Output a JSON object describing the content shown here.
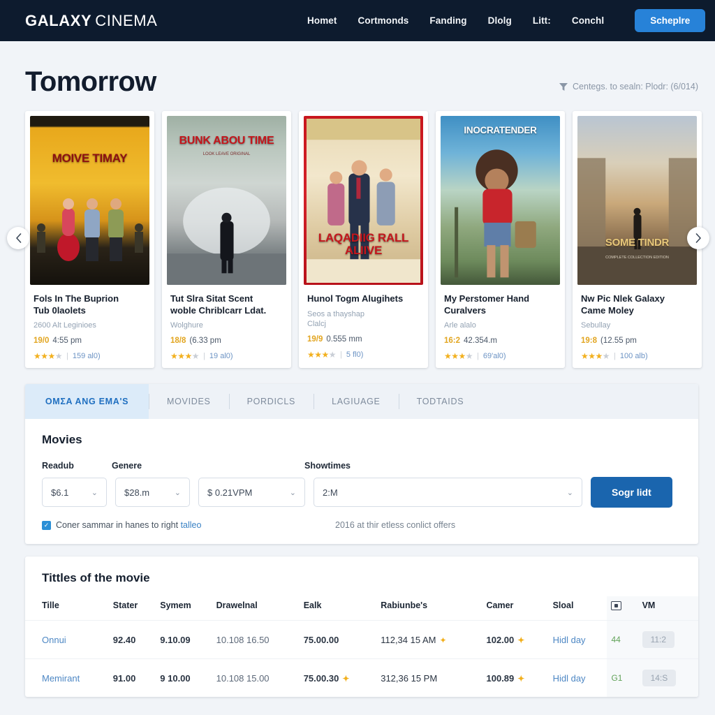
{
  "header": {
    "brand_bold": "GALAXY",
    "brand_light": "CINEMA",
    "nav": [
      {
        "label": "Homet"
      },
      {
        "label": "Cortmonds"
      },
      {
        "label": "Fanding"
      },
      {
        "label": "Dlolg"
      },
      {
        "label": "Litt:"
      },
      {
        "label": "Conchl"
      }
    ],
    "cta_label": "Scheplre"
  },
  "page": {
    "title": "Tomorrow",
    "meta": "Centegs. to sealn: Plodr: (6/014)",
    "filter_icon": "funnel-icon"
  },
  "carousel": {
    "prev_icon": "chevron-left-icon",
    "next_icon": "chevron-right-icon",
    "cards": [
      {
        "poster_text": "MOIVE TIMAY",
        "poster_sub": "",
        "title_l1": "Fols In The Buprion",
        "title_l2": "Tub 0laolets",
        "sub_l1": "2600 Alt Leginioes",
        "sub_l2": "",
        "badge": "19/0",
        "time": "4:55 pm",
        "stars_on": 3,
        "stars_off": 1,
        "count": "159 al0)"
      },
      {
        "poster_text": "BUNK ABOU TIME",
        "poster_sub": "LOOK LEAVE ORIGINAL",
        "title_l1": "Tut Slra Sitat Scent",
        "title_l2": "woble Chriblcarr Ldat.",
        "sub_l1": "Wolghure",
        "sub_l2": "",
        "badge": "18/8",
        "time": "(6.33 pm",
        "stars_on": 3,
        "stars_off": 1,
        "count": "19 al0)"
      },
      {
        "poster_text": "LAQADIIG RALL ALIIVE",
        "poster_sub": "",
        "title_l1": "Hunol Togm Alugihets",
        "title_l2": "",
        "sub_l1": "Seos a thayshap",
        "sub_l2": "Clalcj",
        "badge": "19/9",
        "time": "0.555 mm",
        "stars_on": 3,
        "stars_off": 1,
        "count": "5 fl0)"
      },
      {
        "poster_text": "INOCRATENDER",
        "poster_sub": "",
        "title_l1": "My Perstomer Hand",
        "title_l2": "Curalvers",
        "sub_l1": "Arle alalo",
        "sub_l2": "",
        "badge": "16:2",
        "time": "42.354.m",
        "stars_on": 3,
        "stars_off": 1,
        "count": "69'al0)"
      },
      {
        "poster_text": "SOME TINDR",
        "poster_sub": "COMPLETE COLLECTION EDITION",
        "title_l1": "Nw Pic Nlek Galaxy",
        "title_l2": "Came Moley",
        "sub_l1": "Sebullay",
        "sub_l2": "",
        "badge": "19:8",
        "time": "(12.55 pm",
        "stars_on": 3,
        "stars_off": 1,
        "count": "100 alb)"
      }
    ]
  },
  "tabs": [
    {
      "label": "OMΣA ANG EMA'S",
      "active": true
    },
    {
      "label": "MOVIDES",
      "active": false
    },
    {
      "label": "PORDICLS",
      "active": false
    },
    {
      "label": "LAGIUAGE",
      "active": false
    },
    {
      "label": "TODTAIDS",
      "active": false
    }
  ],
  "filters": {
    "heading": "Movies",
    "label_1": "Readub",
    "label_2": "Genere",
    "label_3": "Showtimes",
    "select_1": "$6.1",
    "select_2": "$28.m",
    "select_3": "$ 0.21VPM",
    "select_4": "2:M",
    "chevron_icon": "chevron-down-icon",
    "search_label": "Sogr lidt",
    "checkbox_icon": "checkbox-checked-icon",
    "checkbox_text": "Coner sammar in hanes to right",
    "checkbox_link": "talleo",
    "note": "2016 at thir etless conlict offers"
  },
  "table": {
    "heading": "Tittles of the movie",
    "columns": [
      "Tille",
      "Stater",
      "Symem",
      "Drawelnal",
      "Ealk",
      "Rabiunbe's",
      "Camer",
      "Sloal",
      "",
      "VM"
    ],
    "column_icon": "display-icon",
    "rows": [
      {
        "title": "Onnui",
        "stater": "92.40",
        "symem": "9.10.09",
        "drawelnal": "10.108 16.50",
        "ealk": "75.00.00",
        "ealk_sparkle": false,
        "rabiunbe": "112,34 15 AM",
        "rabiunbe_sparkle": true,
        "camer": "102.00",
        "camer_sparkle": true,
        "sloal": "Hidl day",
        "num": "44",
        "vm": "11:2"
      },
      {
        "title": "Memirant",
        "stater": "91.00",
        "symem": "9 10.00",
        "drawelnal": "10.108 15.00",
        "ealk": "75.00.30",
        "ealk_sparkle": true,
        "rabiunbe": "312,36 15 PM",
        "rabiunbe_sparkle": false,
        "camer": "100.89",
        "camer_sparkle": true,
        "sloal": "Hidl day",
        "num": "G1",
        "vm": "14:S"
      }
    ]
  }
}
